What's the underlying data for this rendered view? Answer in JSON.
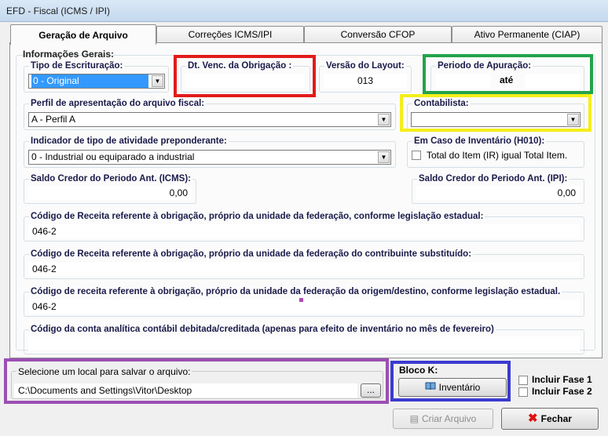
{
  "window": {
    "title": "EFD - Fiscal (ICMS / IPI)"
  },
  "tabs": [
    {
      "label": "Geração de Arquivo",
      "active": true
    },
    {
      "label": "Correções ICMS/IPI",
      "active": false
    },
    {
      "label": "Conversão CFOP",
      "active": false
    },
    {
      "label": "Ativo Permanente (CIAP)",
      "active": false
    }
  ],
  "general": {
    "title": "Informações Gerais:",
    "tipo_escrituracao": {
      "label": "Tipo de Escrituração:",
      "value": "0 - Original"
    },
    "dt_venc": {
      "label": "Dt. Venc. da Obrigação :",
      "value": ""
    },
    "versao_layout": {
      "label": "Versão do Layout:",
      "value": "013"
    },
    "periodo_apuracao": {
      "label": "Periodo de Apuração:",
      "separator": "até",
      "start": "",
      "end": ""
    },
    "perfil": {
      "label": "Perfil de apresentação do arquivo fiscal:",
      "value": "A - Perfil A"
    },
    "contabilista": {
      "label": "Contabilista:",
      "value": ""
    },
    "indicador": {
      "label": "Indicador de tipo de atividade preponderante:",
      "value": "0 - Industrial ou equiparado a industrial"
    },
    "inventario": {
      "label": "Em Caso de Inventário (H010):",
      "checkbox_label": "Total do Item (IR) igual Total Item.",
      "checked": false
    },
    "saldo_icms": {
      "label": "Saldo Credor do Periodo Ant. (ICMS):",
      "value": "0,00"
    },
    "saldo_ipi": {
      "label": "Saldo Credor do Periodo Ant. (IPI):",
      "value": "0,00"
    },
    "cod_receita_estadual": {
      "label": "Código de Receita referente à obrigação, próprio da unidade da federação, conforme legislação estadual:",
      "value": "046-2"
    },
    "cod_receita_substituido": {
      "label": "Código de Receita referente à obrigação, próprio da unidade da federação do contribuinte substituído:",
      "value": "046-2"
    },
    "cod_receita_origem": {
      "label": "Código de receita referente à obrigação, próprio da unidade da federação da origem/destino, conforme legislação estadual.",
      "value": "046-2"
    },
    "conta_analitica": {
      "label": "Código da conta analítica contábil debitada/creditada (apenas para efeito de inventário no mês de fevereiro)",
      "value": ""
    }
  },
  "save": {
    "label": "Selecione um local para salvar o arquivo:",
    "path": "C:\\Documents and Settings\\Vitor\\Desktop",
    "browse_label": "..."
  },
  "bloco_k": {
    "label": "Bloco K:",
    "button_label": "Inventário",
    "fase1": "Incluir Fase 1",
    "fase2": "Incluir Fase 2"
  },
  "actions": {
    "criar": "Criar Arquivo",
    "fechar": "Fechar"
  }
}
